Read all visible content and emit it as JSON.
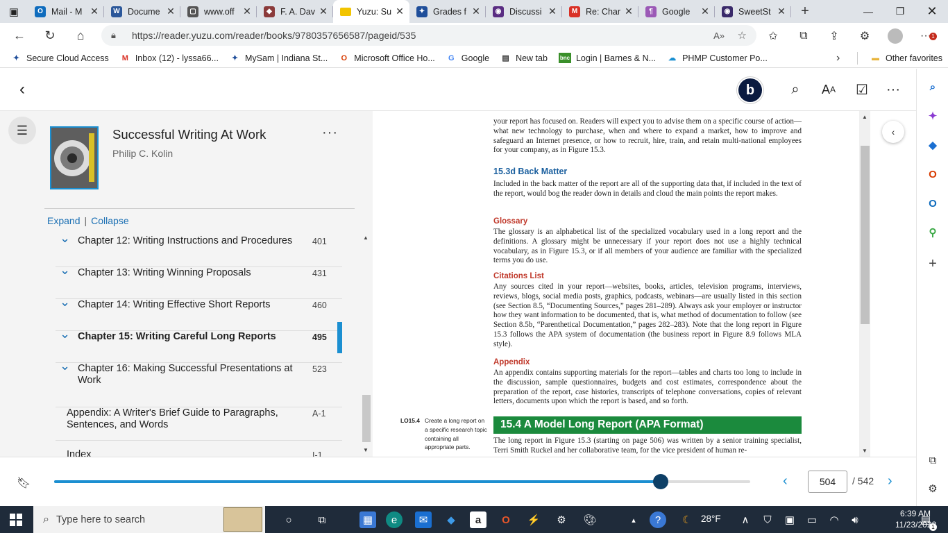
{
  "browser": {
    "tabs": [
      {
        "label": "Mail - M",
        "icon": "outlook-icon",
        "color": "#0f6cbd",
        "glyph": "O"
      },
      {
        "label": "Docume",
        "icon": "word-icon",
        "color": "#2b579a",
        "glyph": "W"
      },
      {
        "label": "www.off",
        "icon": "document-icon",
        "color": "#555555",
        "glyph": "▢"
      },
      {
        "label": "F. A. Dav",
        "icon": "fa-davis-icon",
        "color": "#8b3a3a",
        "glyph": "◆"
      },
      {
        "label": "Yuzu: Su",
        "icon": "yuzu-icon",
        "color": "#f2c400",
        "glyph": "yuzu"
      },
      {
        "label": "Grades f",
        "icon": "indiana-state-icon",
        "color": "#1f4e9a",
        "glyph": "✦"
      },
      {
        "label": "Discussi",
        "icon": "discussion-icon",
        "color": "#5a2d82",
        "glyph": "◉"
      },
      {
        "label": "Re: Char",
        "icon": "gmail-icon",
        "color": "#d93025",
        "glyph": "M"
      },
      {
        "label": "Google",
        "icon": "google-icon",
        "color": "#9b59b6",
        "glyph": "¶"
      },
      {
        "label": "SweetSt",
        "icon": "sweetstudy-icon",
        "color": "#3a2a6a",
        "glyph": "◉"
      }
    ],
    "active_tab_index": 4,
    "url": "https://reader.yuzu.com/reader/books/9780357656587/pageid/535",
    "notification_count": "1",
    "favorites": [
      {
        "label": "Secure Cloud Access",
        "icon": "indiana-state-icon",
        "color": "#1f4e9a",
        "glyph": "✦"
      },
      {
        "label": "Inbox (12) - lyssa66...",
        "icon": "gmail-icon",
        "color": "#d93025",
        "glyph": "M"
      },
      {
        "label": "MySam | Indiana St...",
        "icon": "indiana-state-icon",
        "color": "#1f4e9a",
        "glyph": "✦"
      },
      {
        "label": "Microsoft Office Ho...",
        "icon": "office-icon",
        "color": "#d83b01",
        "glyph": "O"
      },
      {
        "label": "Google",
        "icon": "google-icon",
        "color": "#4285f4",
        "glyph": "G"
      },
      {
        "label": "New tab",
        "icon": "new-tab-icon",
        "color": "#333333",
        "glyph": "▤"
      },
      {
        "label": "Login | Barnes & N...",
        "icon": "barnes-noble-icon",
        "color": "#3a8f2a",
        "glyph": "bnc"
      },
      {
        "label": "PHMP Customer Po...",
        "icon": "cloud-icon",
        "color": "#1a8fd1",
        "glyph": "☁"
      }
    ],
    "other_favorites": "Other favorites"
  },
  "book": {
    "title": "Successful Writing At Work",
    "author": "Philip C. Kolin",
    "expand": "Expand",
    "collapse": "Collapse",
    "toc": [
      {
        "title": "Chapter 12: Writing Instructions and Procedures",
        "page": "401",
        "current": false
      },
      {
        "title": "Chapter 13: Writing Winning Proposals",
        "page": "431",
        "current": false
      },
      {
        "title": "Chapter 14: Writing Effective Short Reports",
        "page": "460",
        "current": false
      },
      {
        "title": "Chapter 15: Writing Careful Long Reports",
        "page": "495",
        "current": true
      },
      {
        "title": "Chapter 16: Making Successful Presentations at Work",
        "page": "523",
        "current": false
      },
      {
        "title": "Appendix: A Writer's Brief Guide to Paragraphs, Sentences, and Words",
        "page": "A-1",
        "current": false
      },
      {
        "title": "Index",
        "page": "I-1",
        "current": false
      }
    ]
  },
  "content": {
    "p1": "your report has focused on. Readers will expect you to advise them on a specific course of action—what new technology to purchase, when and where to expand a market, how to improve and safeguard an Internet presence, or how to recruit, hire, train, and retain multi-national employees for your company, as in Figure 15.3.",
    "h_backmatter": "15.3d  Back Matter",
    "p2": "Included in the back matter of the report are all of the supporting data that, if included in the text of the report, would bog the reader down in details and cloud the main points the report makes.",
    "h_glossary": "Glossary",
    "p3": "The glossary is an alphabetical list of the specialized vocabulary used in a long report and the definitions. A glossary might be unnecessary if your report does not use a highly technical vocabulary, as in Figure 15.3, or if all members of your audience are familiar with the specialized terms you do use.",
    "h_citations": "Citations List",
    "p4": "Any sources cited in your report—websites, books, articles, television programs, interviews, reviews, blogs, social media posts, graphics, podcasts, webinars—are usually listed in this section (see Section 8.5, “Documenting Sources,” pages 281–289). Always ask your employer or instructor how they want information to be documented, that is, what method of documentation to follow (see Section 8.5b, “Parenthetical Documentation,” pages 282–283). Note that the long report in Figure 15.3 follows the APA system of documentation (the business report in Figure 8.9 follows MLA style).",
    "h_appendix": "Appendix",
    "p5": "An appendix contains supporting materials for the report—tables and charts too long to include in the discussion, sample questionnaires, budgets and cost estimates, correspondence about the preparation of the report, case histories, transcripts of telephone conversations, copies of relevant letters, documents upon which the report is based, and so forth.",
    "lo_code": "LO15.4",
    "lo_text": "Create a long report on a specific research topic containing all appropriate parts.",
    "h_model": "15.4  A Model Long Report (APA Format)",
    "p6": "The long report in Figure 15.3 (starting on page 506) was written by a senior training specialist, Terri Smith Ruckel and her collaborative team, for the vice president of human re-"
  },
  "navigation": {
    "current_page": "504",
    "total_pages": "/ 542",
    "progress_fraction": 0.871
  },
  "taskbar": {
    "search_placeholder": "Type here to search",
    "temperature": "28°F",
    "time": "6:39 AM",
    "date": "11/23/2022",
    "notification_badge": "1"
  }
}
